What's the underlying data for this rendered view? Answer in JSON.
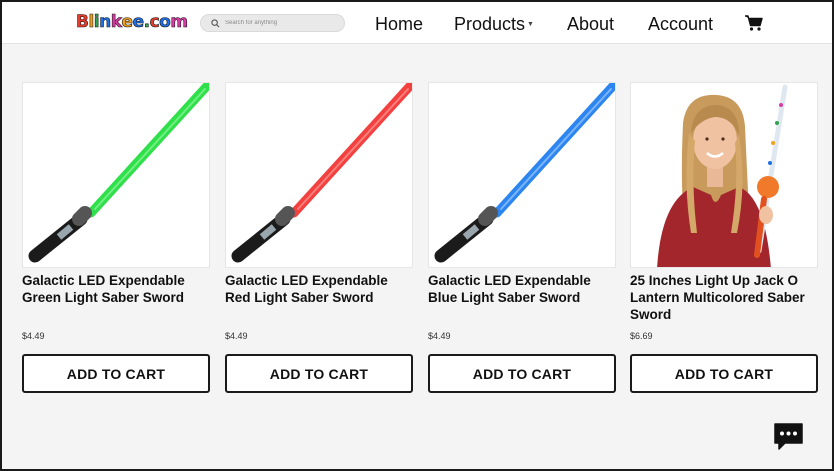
{
  "header": {
    "logo_text": "Blinkee.com",
    "search_placeholder": "Search for anything",
    "nav": {
      "home": "Home",
      "products": "Products",
      "about": "About",
      "account": "Account"
    },
    "icons": {
      "search": "search-icon",
      "cart": "shopping-cart-icon",
      "caret": "chevron-down-icon"
    }
  },
  "products": [
    {
      "name": "Galactic LED Expendable Green Light Saber Sword",
      "price": "$4.49",
      "button": "ADD TO CART",
      "blade_color": "#2fe04a"
    },
    {
      "name": "Galactic LED Expendable Red Light Saber Sword",
      "price": "$4.49",
      "button": "ADD TO CART",
      "blade_color": "#f2413f"
    },
    {
      "name": "Galactic LED Expendable Blue Light Saber Sword",
      "price": "$4.49",
      "button": "ADD TO CART",
      "blade_color": "#2d86f0"
    },
    {
      "name": "25 Inches Light Up Jack O Lantern Multicolored Saber Sword",
      "price": "$6.69",
      "button": "ADD TO CART",
      "blade_color": "#f07a2a"
    }
  ],
  "chat": {
    "icon": "chat-bubble-icon"
  },
  "colors": {
    "background": "#f4f4f4",
    "header": "#ffffff",
    "button_border": "#1a1a1a",
    "logo_letters": [
      "#e63c2e",
      "#f2a21a",
      "#2da44e",
      "#1f6fe5",
      "#d93aa5",
      "#f2a21a",
      "#1f6fe5",
      "#2da44e",
      "#e63c2e",
      "#1f6fe5",
      "#d93aa5"
    ]
  }
}
